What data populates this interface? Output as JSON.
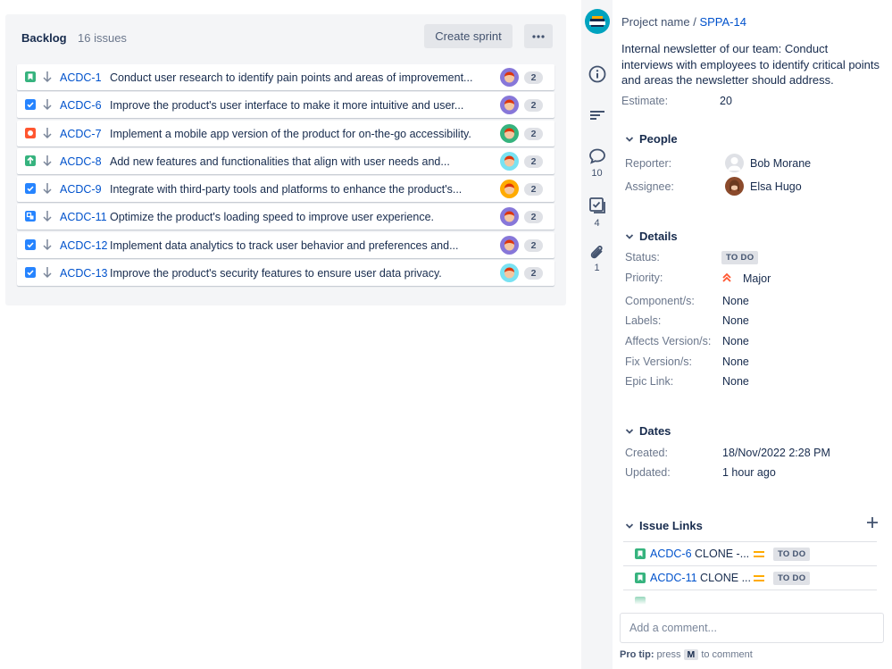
{
  "backlog": {
    "title": "Backlog",
    "count": "16 issues",
    "create_sprint_label": "Create sprint",
    "more_label": "···",
    "issues": [
      {
        "key": "ACDC-1",
        "summary": "Conduct user research to identify pain points and areas of improvement...",
        "type": "story",
        "type_color": "#36b37e",
        "points": "2",
        "avatar_color": "#8777d9"
      },
      {
        "key": "ACDC-6",
        "summary": "Improve the product's user interface to make it more intuitive and user...",
        "type": "task",
        "type_color": "#2684ff",
        "points": "2",
        "avatar_color": "#8777d9"
      },
      {
        "key": "ACDC-7",
        "summary": "Implement a mobile app version of the product for on-the-go accessibility.",
        "type": "bug",
        "type_color": "#ff5630",
        "points": "2",
        "avatar_color": "#36b37e"
      },
      {
        "key": "ACDC-8",
        "summary": "Add new features and functionalities that align with user needs and...",
        "type": "improvement",
        "type_color": "#36b37e",
        "points": "2",
        "avatar_color": "#79e2f2"
      },
      {
        "key": "ACDC-9",
        "summary": "Integrate with third-party tools and platforms to enhance the product's...",
        "type": "task",
        "type_color": "#2684ff",
        "points": "2",
        "avatar_color": "#ffab00"
      },
      {
        "key": "ACDC-11",
        "summary": "Optimize the product's loading speed to improve user experience.",
        "type": "subtask",
        "type_color": "#2684ff",
        "points": "2",
        "avatar_color": "#8777d9"
      },
      {
        "key": "ACDC-12",
        "summary": "Implement data analytics to track user behavior and preferences and...",
        "type": "task",
        "type_color": "#2684ff",
        "points": "2",
        "avatar_color": "#8777d9"
      },
      {
        "key": "ACDC-13",
        "summary": "Improve the product's security features to ensure user data privacy.",
        "type": "task",
        "type_color": "#2684ff",
        "points": "2",
        "avatar_color": "#79e2f2"
      }
    ]
  },
  "rail": {
    "comments_count": "10",
    "checklist_count": "4",
    "attachments_count": "1"
  },
  "detail": {
    "project": "Project name / ",
    "issue_key": "SPPA-14",
    "description": "Internal newsletter of our team: Conduct interviews with employees to identify critical points and areas the newsletter should address.",
    "estimate_label": "Estimate:",
    "estimate_value": "20",
    "people": {
      "title": "People",
      "reporter_label": "Reporter:",
      "reporter": "Bob Morane",
      "assignee_label": "Assignee:",
      "assignee": "Elsa Hugo"
    },
    "details": {
      "title": "Details",
      "status_label": "Status:",
      "status": "TO DO",
      "priority_label": "Priority:",
      "priority": "Major",
      "component_label": "Component/s:",
      "component": "None",
      "labels_label": "Labels:",
      "labels": "None",
      "affects_label": "Affects Version/s:",
      "affects": "None",
      "fix_label": "Fix Version/s:",
      "fix": "None",
      "epic_label": "Epic Link:",
      "epic": "None"
    },
    "dates": {
      "title": "Dates",
      "created_label": "Created:",
      "created": "18/Nov/2022 2:28 PM",
      "updated_label": "Updated:",
      "updated": "1 hour ago"
    },
    "issue_links": {
      "title": "Issue Links",
      "links": [
        {
          "key": "ACDC-6",
          "text": " CLONE -...",
          "status": "TO DO"
        },
        {
          "key": "ACDC-11",
          "text": " CLONE ...",
          "status": "TO DO"
        }
      ]
    },
    "comment_placeholder": "Add a comment...",
    "pro_tip_label": "Pro tip:",
    "pro_tip_press": " press ",
    "pro_tip_key": "M",
    "pro_tip_rest": " to comment"
  },
  "colors": {
    "link": "#0052cc",
    "priority_major": "#ff5630",
    "medium_priority": "#ffab00"
  }
}
